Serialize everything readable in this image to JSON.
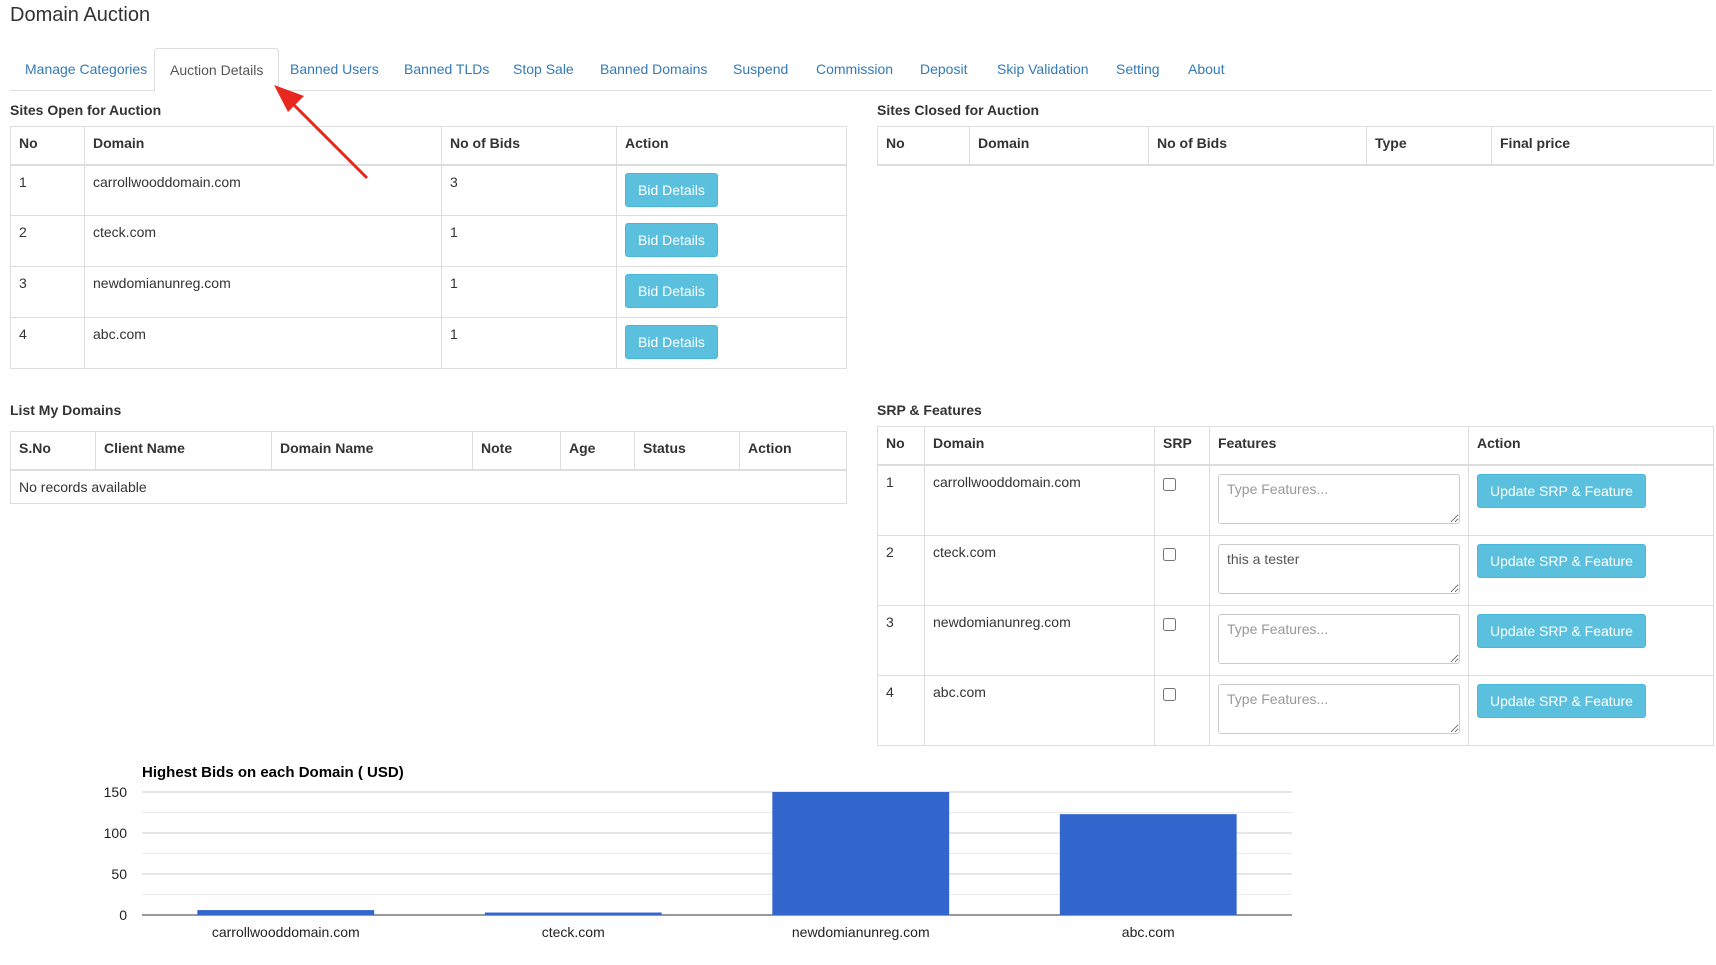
{
  "page": {
    "title": "Domain Auction"
  },
  "tabs": [
    {
      "label": "Manage Categories",
      "active": false
    },
    {
      "label": "Auction Details",
      "active": true
    },
    {
      "label": "Banned Users",
      "active": false
    },
    {
      "label": "Banned TLDs",
      "active": false
    },
    {
      "label": "Stop Sale",
      "active": false
    },
    {
      "label": "Banned Domains",
      "active": false
    },
    {
      "label": "Suspend",
      "active": false
    },
    {
      "label": "Commission",
      "active": false
    },
    {
      "label": "Deposit",
      "active": false
    },
    {
      "label": "Skip Validation",
      "active": false
    },
    {
      "label": "Setting",
      "active": false
    },
    {
      "label": "About",
      "active": false
    }
  ],
  "open_auction": {
    "title": "Sites Open for Auction",
    "headers": [
      "No",
      "Domain",
      "No of Bids",
      "Action"
    ],
    "rows": [
      {
        "no": "1",
        "domain": "carrollwooddomain.com",
        "bids": "3",
        "action": "Bid Details"
      },
      {
        "no": "2",
        "domain": "cteck.com",
        "bids": "1",
        "action": "Bid Details"
      },
      {
        "no": "3",
        "domain": "newdomianunreg.com",
        "bids": "1",
        "action": "Bid Details"
      },
      {
        "no": "4",
        "domain": "abc.com",
        "bids": "1",
        "action": "Bid Details"
      }
    ]
  },
  "closed_auction": {
    "title": "Sites Closed for Auction",
    "headers": [
      "No",
      "Domain",
      "No of Bids",
      "Type",
      "Final price"
    ]
  },
  "my_domains": {
    "title": "List My Domains",
    "headers": [
      "S.No",
      "Client Name",
      "Domain Name",
      "Note",
      "Age",
      "Status",
      "Action"
    ],
    "empty_text": "No records available"
  },
  "srp": {
    "title": "SRP & Features",
    "headers": [
      "No",
      "Domain",
      "SRP",
      "Features",
      "Action"
    ],
    "placeholder": "Type Features...",
    "button_label": "Update SRP & Feature",
    "rows": [
      {
        "no": "1",
        "domain": "carrollwooddomain.com",
        "srp": false,
        "features": ""
      },
      {
        "no": "2",
        "domain": "cteck.com",
        "srp": false,
        "features": "this a tester"
      },
      {
        "no": "3",
        "domain": "newdomianunreg.com",
        "srp": false,
        "features": ""
      },
      {
        "no": "4",
        "domain": "abc.com",
        "srp": false,
        "features": ""
      }
    ]
  },
  "colors": {
    "link": "#337ab7",
    "button": "#5bc0de",
    "bar": "#3366cc",
    "arrow": "#e8281f"
  },
  "chart_data": {
    "type": "bar",
    "title": "Highest Bids on each Domain ( USD)",
    "categories": [
      "carrollwooddomain.com",
      "cteck.com",
      "newdomianunreg.com",
      "abc.com"
    ],
    "values": [
      6,
      3,
      150,
      123
    ],
    "ylim": [
      0,
      150
    ],
    "yticks": [
      0,
      50,
      100,
      150
    ],
    "grid": true,
    "xlabel": "",
    "ylabel": ""
  }
}
